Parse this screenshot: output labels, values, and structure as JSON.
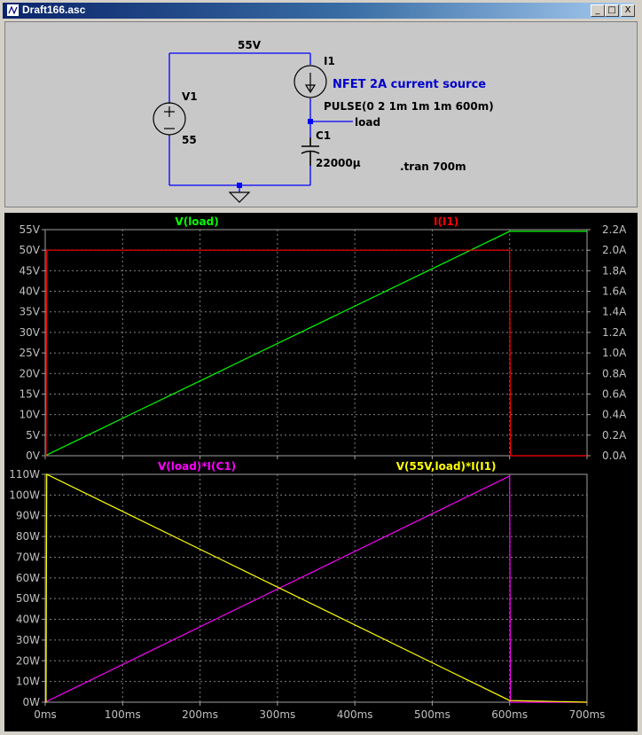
{
  "window": {
    "title": "Draft166.asc",
    "buttons": {
      "minimize": "_",
      "maximize": "□",
      "close": "X"
    }
  },
  "schematic": {
    "net_55v": "55V",
    "v1": {
      "name": "V1",
      "value": "55"
    },
    "i1": {
      "name": "I1",
      "comment": "NFET 2A current source",
      "value": "PULSE(0 2 1m 1m 1m 600m)"
    },
    "load_label": "load",
    "c1": {
      "name": "C1",
      "value": "22000µ"
    },
    "directive": ".tran 700m",
    "colors": {
      "wire": "#0000ff",
      "component": "#000000",
      "comment": "#0000cc"
    }
  },
  "chart_data": [
    {
      "type": "line",
      "pane": "top",
      "x": {
        "ticks": [
          "0ms",
          "100ms",
          "200ms",
          "300ms",
          "400ms",
          "500ms",
          "600ms",
          "700ms"
        ],
        "range": [
          0,
          700
        ],
        "unit": "ms"
      },
      "y_left": {
        "ticks": [
          "0V",
          "5V",
          "10V",
          "15V",
          "20V",
          "25V",
          "30V",
          "35V",
          "40V",
          "45V",
          "50V",
          "55V"
        ],
        "range": [
          0,
          55
        ],
        "unit": "V"
      },
      "y_right": {
        "ticks": [
          "0.0A",
          "0.2A",
          "0.4A",
          "0.6A",
          "0.8A",
          "1.0A",
          "1.2A",
          "1.4A",
          "1.6A",
          "1.8A",
          "2.0A",
          "2.2A"
        ],
        "range": [
          0,
          2.2
        ],
        "unit": "A"
      },
      "series": [
        {
          "name": "V(load)",
          "color": "#00ff00",
          "axis": "left",
          "points": [
            [
              0,
              0
            ],
            [
              600,
              54.6
            ],
            [
              700,
              54.6
            ]
          ]
        },
        {
          "name": "I(I1)",
          "color": "#ff0000",
          "axis": "right",
          "points": [
            [
              0,
              0
            ],
            [
              1,
              0
            ],
            [
              2,
              2.0
            ],
            [
              600,
              2.0
            ],
            [
              601,
              0
            ],
            [
              700,
              0
            ]
          ]
        }
      ],
      "grid": true
    },
    {
      "type": "line",
      "pane": "bottom",
      "x": {
        "ticks": [
          "0ms",
          "100ms",
          "200ms",
          "300ms",
          "400ms",
          "500ms",
          "600ms",
          "700ms"
        ],
        "range": [
          0,
          700
        ],
        "unit": "ms"
      },
      "y_left": {
        "ticks": [
          "0W",
          "10W",
          "20W",
          "30W",
          "40W",
          "50W",
          "60W",
          "70W",
          "80W",
          "90W",
          "100W",
          "110W"
        ],
        "range": [
          0,
          110
        ],
        "unit": "W"
      },
      "series": [
        {
          "name": "V(load)*I(C1)",
          "color": "#ff00ff",
          "axis": "left",
          "points": [
            [
              0,
              0
            ],
            [
              600,
              109.2
            ],
            [
              601,
              0
            ],
            [
              700,
              0
            ]
          ]
        },
        {
          "name": "V(55V,load)*I(I1)",
          "color": "#ffff00",
          "axis": "left",
          "points": [
            [
              0,
              0
            ],
            [
              1,
              0
            ],
            [
              2,
              110
            ],
            [
              600,
              0.8
            ],
            [
              700,
              0
            ]
          ]
        }
      ],
      "grid": true
    }
  ]
}
